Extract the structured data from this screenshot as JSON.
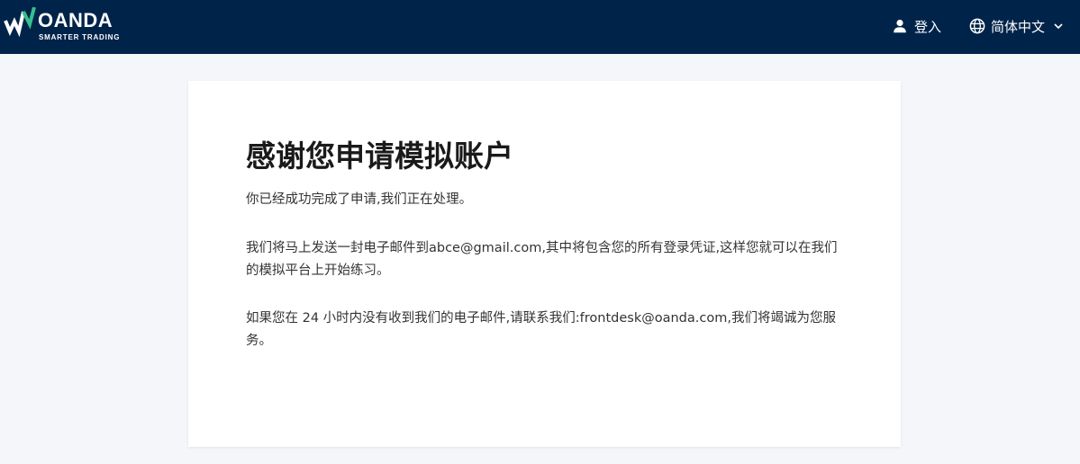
{
  "header": {
    "brand": "OANDA",
    "tagline": "SMARTER TRADING",
    "login_icon": "user-icon",
    "login_label": "登入",
    "language_icon": "globe-icon",
    "language_label": "简体中文",
    "language_chevron": "chevron-down-icon",
    "colors": {
      "background": "#00234a",
      "accent": "#35c08e",
      "text": "#ffffff"
    }
  },
  "confirmation": {
    "title": "感谢您申请模拟账户",
    "paragraphs": [
      "你已经成功完成了申请,我们正在处理。",
      "我们将马上发送一封电子邮件到abce@gmail.com,其中将包含您的所有登录凭证,这样您就可以在我们的模拟平台上开始练习。",
      "如果您在 24 小时内没有收到我们的电子邮件,请联系我们:frontdesk@oanda.com,我们将竭诚为您服务。"
    ]
  }
}
